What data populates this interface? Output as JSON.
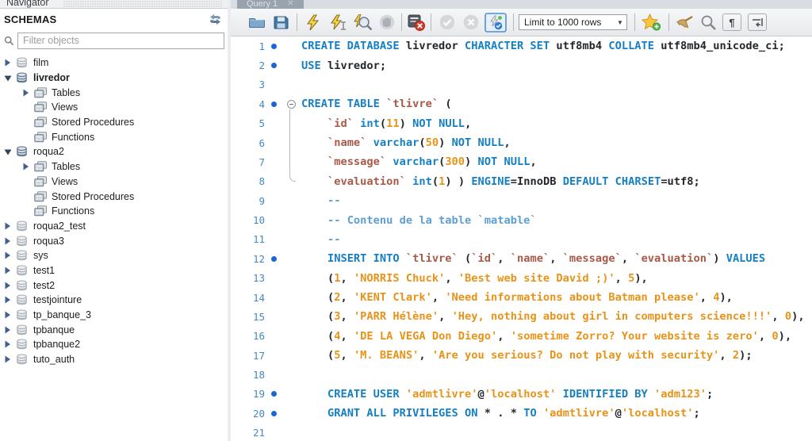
{
  "sidebar": {
    "title": "Navigator",
    "section": "SCHEMAS",
    "filter_placeholder": "Filter objects",
    "tree": [
      {
        "label": "film",
        "level": 0,
        "arrow": "collapsed",
        "icon": "schema",
        "dim": true
      },
      {
        "label": "livredor",
        "level": 0,
        "arrow": "expanded",
        "icon": "schema",
        "dim": false,
        "bold": true
      },
      {
        "label": "Tables",
        "level": 1,
        "arrow": "collapsed",
        "icon": "folder"
      },
      {
        "label": "Views",
        "level": 1,
        "arrow": "none",
        "icon": "folder"
      },
      {
        "label": "Stored Procedures",
        "level": 1,
        "arrow": "none",
        "icon": "folder"
      },
      {
        "label": "Functions",
        "level": 1,
        "arrow": "none",
        "icon": "folder"
      },
      {
        "label": "roqua2",
        "level": 0,
        "arrow": "expanded",
        "icon": "schema",
        "dim": false
      },
      {
        "label": "Tables",
        "level": 1,
        "arrow": "collapsed",
        "icon": "folder"
      },
      {
        "label": "Views",
        "level": 1,
        "arrow": "none",
        "icon": "folder"
      },
      {
        "label": "Stored Procedures",
        "level": 1,
        "arrow": "none",
        "icon": "folder"
      },
      {
        "label": "Functions",
        "level": 1,
        "arrow": "none",
        "icon": "folder"
      },
      {
        "label": "roqua2_test",
        "level": 0,
        "arrow": "collapsed",
        "icon": "schema",
        "dim": true
      },
      {
        "label": "roqua3",
        "level": 0,
        "arrow": "collapsed",
        "icon": "schema",
        "dim": true
      },
      {
        "label": "sys",
        "level": 0,
        "arrow": "collapsed",
        "icon": "schema",
        "dim": true
      },
      {
        "label": "test1",
        "level": 0,
        "arrow": "collapsed",
        "icon": "schema",
        "dim": true
      },
      {
        "label": "test2",
        "level": 0,
        "arrow": "collapsed",
        "icon": "schema",
        "dim": true
      },
      {
        "label": "testjointure",
        "level": 0,
        "arrow": "collapsed",
        "icon": "schema",
        "dim": true
      },
      {
        "label": "tp_banque_3",
        "level": 0,
        "arrow": "collapsed",
        "icon": "schema",
        "dim": true
      },
      {
        "label": "tpbanque",
        "level": 0,
        "arrow": "collapsed",
        "icon": "schema",
        "dim": true
      },
      {
        "label": "tpbanque2",
        "level": 0,
        "arrow": "collapsed",
        "icon": "schema",
        "dim": true
      },
      {
        "label": "tuto_auth",
        "level": 0,
        "arrow": "collapsed",
        "icon": "schema",
        "dim": true
      }
    ]
  },
  "editor": {
    "tab_title": "Query 1",
    "toolbar": {
      "limit_label": "Limit to 1000 rows",
      "buttons": [
        "open-file",
        "save",
        "execute-all",
        "execute-current",
        "explain",
        "stop",
        "toggle-stop-on-error",
        "commit",
        "rollback",
        "toggle-autocommit",
        "limit-select",
        "save-snippet",
        "beautify",
        "find",
        "toggle-invisibles",
        "toggle-wrap"
      ]
    },
    "colors": {
      "keyword": "#157fc4",
      "identifier": "#a85948",
      "literal": "#e89318",
      "comment": "#5d9fd3",
      "text": "#23272c",
      "line_number": "#4288c6",
      "marker": "#1b66d4"
    },
    "lines": [
      {
        "n": 1,
        "dot": true,
        "s": [
          [
            "k",
            "CREATE DATABASE "
          ],
          [
            "t",
            "livredor "
          ],
          [
            "k",
            "CHARACTER SET "
          ],
          [
            "t",
            "utf8mb4 "
          ],
          [
            "k",
            "COLLATE "
          ],
          [
            "t",
            "utf8mb4_unicode_ci;"
          ]
        ]
      },
      {
        "n": 2,
        "dot": true,
        "s": [
          [
            "k",
            "USE "
          ],
          [
            "t",
            "livredor;"
          ]
        ]
      },
      {
        "n": 3,
        "s": []
      },
      {
        "n": 4,
        "dot": true,
        "fold": true,
        "s": [
          [
            "k",
            "CREATE TABLE "
          ],
          [
            "i",
            "`tlivre` "
          ],
          [
            "t",
            "("
          ]
        ]
      },
      {
        "n": 5,
        "s": [
          [
            "t",
            "    "
          ],
          [
            "i",
            "`id` "
          ],
          [
            "k",
            "int"
          ],
          [
            "t",
            "("
          ],
          [
            "l",
            "11"
          ],
          [
            "t",
            ") "
          ],
          [
            "k",
            "NOT NULL"
          ],
          [
            "t",
            ","
          ]
        ]
      },
      {
        "n": 6,
        "s": [
          [
            "t",
            "    "
          ],
          [
            "i",
            "`name` "
          ],
          [
            "k",
            "varchar"
          ],
          [
            "t",
            "("
          ],
          [
            "l",
            "50"
          ],
          [
            "t",
            ") "
          ],
          [
            "k",
            "NOT NULL"
          ],
          [
            "t",
            ","
          ]
        ]
      },
      {
        "n": 7,
        "s": [
          [
            "t",
            "    "
          ],
          [
            "i",
            "`message` "
          ],
          [
            "k",
            "varchar"
          ],
          [
            "t",
            "("
          ],
          [
            "l",
            "300"
          ],
          [
            "t",
            ") "
          ],
          [
            "k",
            "NOT NULL"
          ],
          [
            "t",
            ","
          ]
        ]
      },
      {
        "n": 8,
        "s": [
          [
            "t",
            "    "
          ],
          [
            "i",
            "`evaluation` "
          ],
          [
            "k",
            "int"
          ],
          [
            "t",
            "("
          ],
          [
            "l",
            "1"
          ],
          [
            "t",
            ") ) "
          ],
          [
            "k",
            "ENGINE"
          ],
          [
            "t",
            "=InnoDB "
          ],
          [
            "k",
            "DEFAULT CHARSET"
          ],
          [
            "t",
            "=utf8;"
          ]
        ]
      },
      {
        "n": 9,
        "s": [
          [
            "t",
            "    "
          ],
          [
            "c",
            "--"
          ]
        ]
      },
      {
        "n": 10,
        "s": [
          [
            "t",
            "    "
          ],
          [
            "c",
            "-- Contenu de la table `matable`"
          ]
        ]
      },
      {
        "n": 11,
        "s": [
          [
            "t",
            "    "
          ],
          [
            "c",
            "--"
          ]
        ]
      },
      {
        "n": 12,
        "dot": true,
        "s": [
          [
            "t",
            "    "
          ],
          [
            "k",
            "INSERT INTO "
          ],
          [
            "i",
            "`tlivre` "
          ],
          [
            "t",
            "("
          ],
          [
            "i",
            "`id`"
          ],
          [
            "t",
            ", "
          ],
          [
            "i",
            "`name`"
          ],
          [
            "t",
            ", "
          ],
          [
            "i",
            "`message`"
          ],
          [
            "t",
            ", "
          ],
          [
            "i",
            "`evaluation`"
          ],
          [
            "t",
            ") "
          ],
          [
            "k",
            "VALUES"
          ]
        ]
      },
      {
        "n": 13,
        "s": [
          [
            "t",
            "    ("
          ],
          [
            "l",
            "1"
          ],
          [
            "t",
            ", "
          ],
          [
            "l",
            "'NORRIS Chuck'"
          ],
          [
            "t",
            ", "
          ],
          [
            "l",
            "'Best web site David ;)'"
          ],
          [
            "t",
            ", "
          ],
          [
            "l",
            "5"
          ],
          [
            "t",
            "),"
          ]
        ]
      },
      {
        "n": 14,
        "s": [
          [
            "t",
            "    ("
          ],
          [
            "l",
            "2"
          ],
          [
            "t",
            ", "
          ],
          [
            "l",
            "'KENT Clark'"
          ],
          [
            "t",
            ", "
          ],
          [
            "l",
            "'Need informations about Batman please'"
          ],
          [
            "t",
            ", "
          ],
          [
            "l",
            "4"
          ],
          [
            "t",
            "),"
          ]
        ]
      },
      {
        "n": 15,
        "s": [
          [
            "t",
            "    ("
          ],
          [
            "l",
            "3"
          ],
          [
            "t",
            ", "
          ],
          [
            "l",
            "'PARR Hélène'"
          ],
          [
            "t",
            ", "
          ],
          [
            "l",
            "'Hey, nothing about girl in computers science!!!'"
          ],
          [
            "t",
            ", "
          ],
          [
            "l",
            "0"
          ],
          [
            "t",
            "),"
          ]
        ]
      },
      {
        "n": 16,
        "s": [
          [
            "t",
            "    ("
          ],
          [
            "l",
            "4"
          ],
          [
            "t",
            ", "
          ],
          [
            "l",
            "'DE LA VEGA Don Diego'"
          ],
          [
            "t",
            ", "
          ],
          [
            "l",
            "'sometime Zorro? Your website is zero'"
          ],
          [
            "t",
            ", "
          ],
          [
            "l",
            "0"
          ],
          [
            "t",
            "),"
          ]
        ]
      },
      {
        "n": 17,
        "s": [
          [
            "t",
            "    ("
          ],
          [
            "l",
            "5"
          ],
          [
            "t",
            ", "
          ],
          [
            "l",
            "'M. BEANS'"
          ],
          [
            "t",
            ", "
          ],
          [
            "l",
            "'Are you serious? Do not play with security'"
          ],
          [
            "t",
            ", "
          ],
          [
            "l",
            "2"
          ],
          [
            "t",
            ");"
          ]
        ]
      },
      {
        "n": 18,
        "s": []
      },
      {
        "n": 19,
        "dot": true,
        "s": [
          [
            "t",
            "    "
          ],
          [
            "k",
            "CREATE USER "
          ],
          [
            "l",
            "'admtlivre'"
          ],
          [
            "t",
            "@"
          ],
          [
            "l",
            "'localhost' "
          ],
          [
            "k",
            "IDENTIFIED BY "
          ],
          [
            "l",
            "'adm123'"
          ],
          [
            "t",
            ";"
          ]
        ]
      },
      {
        "n": 20,
        "dot": true,
        "s": [
          [
            "t",
            "    "
          ],
          [
            "k",
            "GRANT ALL PRIVILEGES ON "
          ],
          [
            "t",
            "* . * "
          ],
          [
            "k",
            "TO "
          ],
          [
            "l",
            "'admtlivre'"
          ],
          [
            "t",
            "@"
          ],
          [
            "l",
            "'localhost'"
          ],
          [
            "t",
            ";"
          ]
        ]
      },
      {
        "n": 21,
        "s": []
      }
    ]
  }
}
